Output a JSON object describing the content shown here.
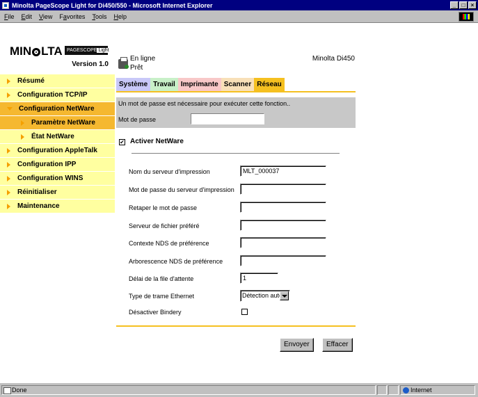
{
  "window": {
    "title": "Minolta PageScope Light for Di450/550 - Microsoft Internet Explorer",
    "buttons": [
      "_",
      "□",
      "×"
    ]
  },
  "menu": [
    "File",
    "Edit",
    "View",
    "Favorites",
    "Tools",
    "Help"
  ],
  "brand": {
    "logo_left": "MIN",
    "logo_right": "LTA",
    "badge_left": "PAGESCOPE",
    "badge_right": "Light",
    "version": "Version 1.0"
  },
  "printer": {
    "status_line1": "En ligne",
    "status_line2": "Prêt",
    "model": "Minolta Di450"
  },
  "tabs": [
    "Système",
    "Travail",
    "Imprimante",
    "Scanner",
    "Réseau"
  ],
  "sidebar": {
    "items": [
      {
        "label": "Résumé"
      },
      {
        "label": "Configuration TCP/IP"
      },
      {
        "label": "Configuration NetWare"
      },
      {
        "label": "Paramètre NetWare"
      },
      {
        "label": "État NetWare"
      },
      {
        "label": "Configuration AppleTalk"
      },
      {
        "label": "Configuration IPP"
      },
      {
        "label": "Configuration WINS"
      },
      {
        "label": "Réinitialiser"
      },
      {
        "label": "Maintenance"
      }
    ]
  },
  "password": {
    "message": "Un mot de passe est nécessaire pour exécuter cette fonction..",
    "label": "Mot de passe",
    "value": ""
  },
  "netware": {
    "enable_label": "Activer NetWare",
    "enable_checked": "✔",
    "fields": [
      {
        "label": "Nom du serveur d'impression",
        "value": "MLT_000037"
      },
      {
        "label": "Mot de passe du serveur d'impression",
        "value": ""
      },
      {
        "label": "Retaper le mot de passe",
        "value": ""
      },
      {
        "label": "Serveur de fichier préféré",
        "value": ""
      },
      {
        "label": "Contexte NDS de préférence",
        "value": ""
      },
      {
        "label": "Arborescence NDS de préférence",
        "value": ""
      },
      {
        "label": "Délai de la file d'attente",
        "value": "1"
      }
    ],
    "frame_type_label": "Type de trame Ethernet",
    "frame_type_value": "Détection auto",
    "bindery_label": "Désactiver Bindery",
    "bindery_checked": ""
  },
  "actions": {
    "submit": "Envoyer",
    "reset": "Effacer"
  },
  "statusbar": {
    "status": "Done",
    "zone": "Internet"
  }
}
